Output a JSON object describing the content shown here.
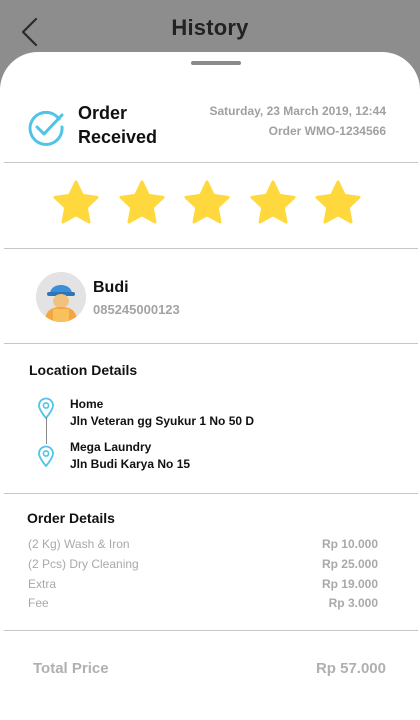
{
  "header": {
    "title": "History"
  },
  "order": {
    "status": "Order Received",
    "datetime": "Saturday, 23 March 2019, 12:44",
    "order_id": "Order WMO-1234566"
  },
  "rating": {
    "value": 5,
    "max": 5,
    "star_color": "#ffd83d"
  },
  "user": {
    "name": "Budi",
    "phone": "085245000123"
  },
  "location": {
    "title": "Location Details",
    "stops": [
      {
        "name": "Home",
        "address": "Jln Veteran gg Syukur 1 No 50 D"
      },
      {
        "name": "Mega Laundry",
        "address": "Jln Budi Karya No 15"
      }
    ]
  },
  "order_details": {
    "title": "Order Details",
    "items": [
      {
        "label": "(2 Kg) Wash & Iron",
        "price": "Rp 10.000"
      },
      {
        "label": "(2 Pcs) Dry Cleaning",
        "price": "Rp 25.000"
      },
      {
        "label": "Extra",
        "price": "Rp 19.000"
      },
      {
        "label": "Fee",
        "price": "Rp 3.000"
      }
    ]
  },
  "total": {
    "label": "Total Price",
    "value": "Rp 57.000"
  },
  "colors": {
    "accent": "#4fc3e8",
    "backdrop": "#8d8d8d"
  }
}
